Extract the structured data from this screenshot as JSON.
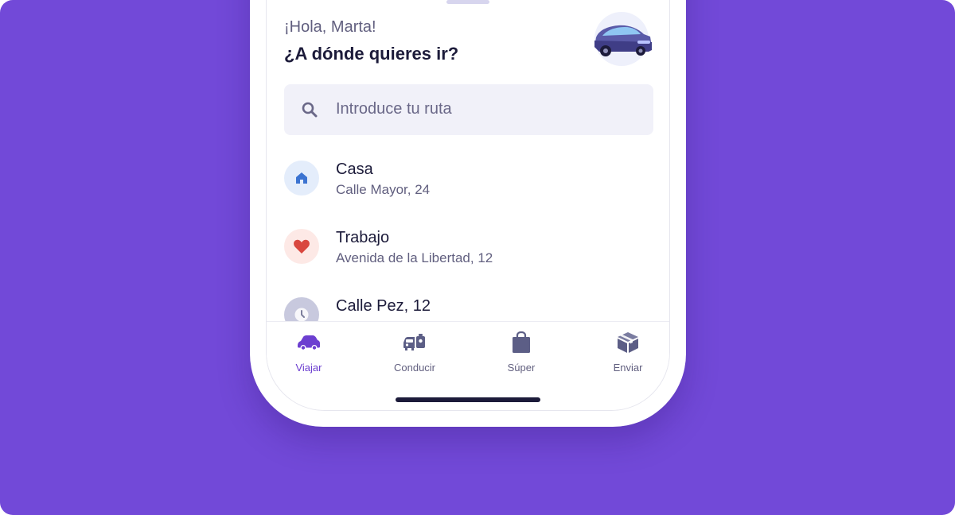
{
  "header": {
    "greeting": "¡Hola, Marta!",
    "question": "¿A dónde quieres ir?"
  },
  "search": {
    "placeholder": "Introduce tu ruta",
    "icon": "search-icon"
  },
  "places": [
    {
      "title": "Casa",
      "subtitle": "Calle Mayor, 24",
      "icon": "home-icon",
      "icon_bg": "#e4edfb",
      "icon_color": "#3b73d1"
    },
    {
      "title": "Trabajo",
      "subtitle": "Avenida de la Libertad, 12",
      "icon": "heart-icon",
      "icon_bg": "#fde9e6",
      "icon_color": "#d9473f"
    },
    {
      "title": "Calle Pez, 12",
      "subtitle": "",
      "icon": "clock-icon",
      "icon_bg": "#c8c9de",
      "icon_color": "#7d7f9d"
    }
  ],
  "tabs": [
    {
      "label": "Viajar",
      "icon": "car-icon",
      "active": true
    },
    {
      "label": "Conducir",
      "icon": "rental-car-icon",
      "active": false
    },
    {
      "label": "Súper",
      "icon": "shopping-bag-icon",
      "active": false
    },
    {
      "label": "Enviar",
      "icon": "package-icon",
      "active": false
    }
  ],
  "colors": {
    "background": "#7249d8",
    "accent": "#6c3fd0",
    "text_primary": "#1c1b3a",
    "text_secondary": "#615f7f",
    "search_bg": "#f1f1f9"
  }
}
